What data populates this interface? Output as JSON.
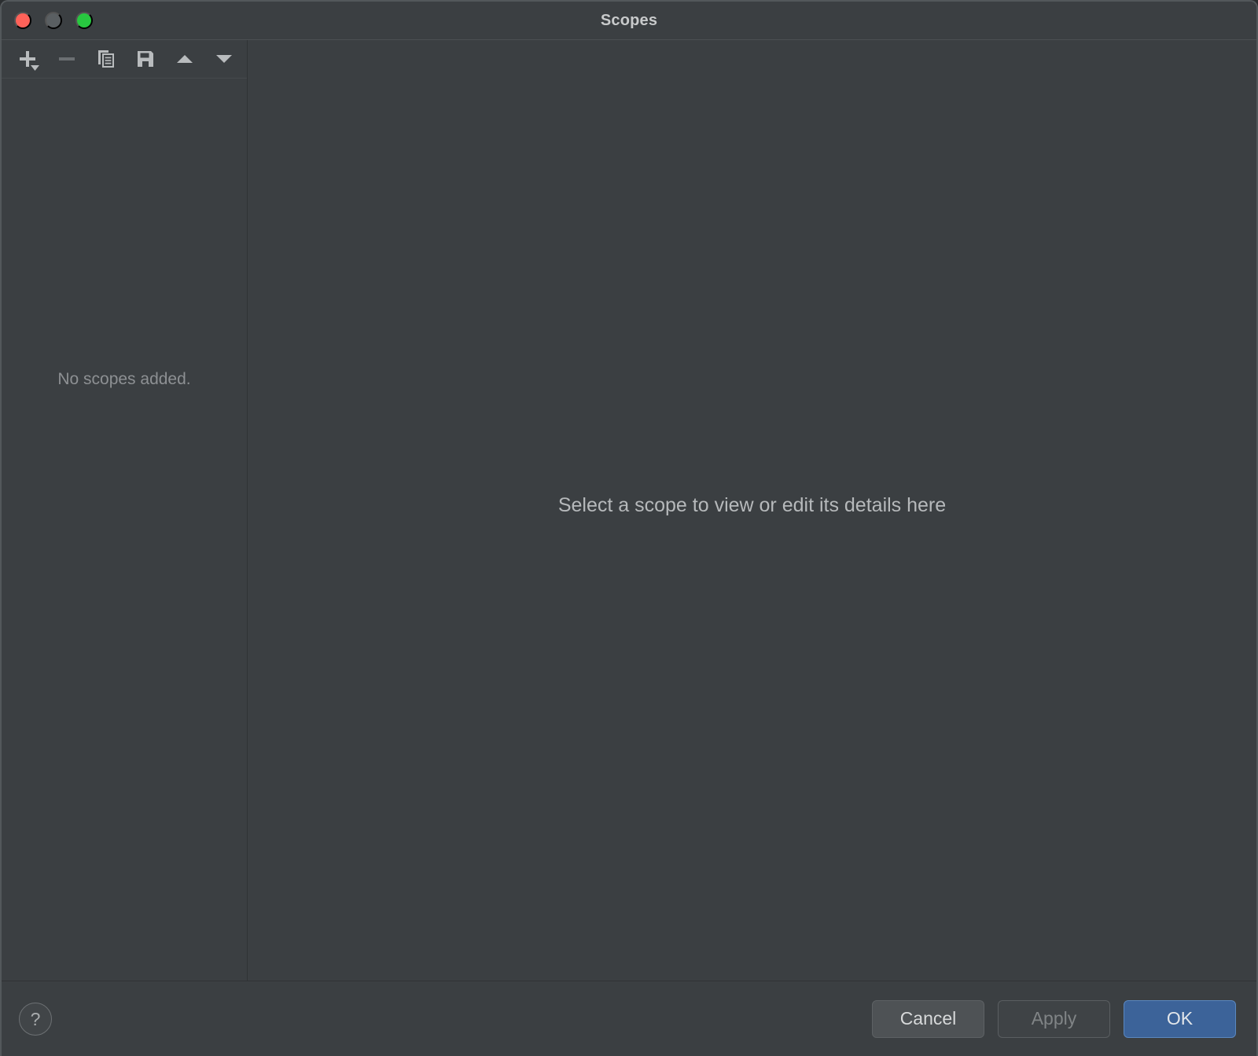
{
  "window": {
    "title": "Scopes",
    "traffic_lights": [
      {
        "name": "close",
        "color": "#ff6259"
      },
      {
        "name": "minimize",
        "color": "#5a5f62"
      },
      {
        "name": "zoom",
        "color": "#28c840"
      }
    ]
  },
  "toolbar": {
    "buttons": [
      {
        "icon": "add-icon",
        "label": "Add Scope",
        "enabled": true,
        "has_dropdown": true
      },
      {
        "icon": "remove-icon",
        "label": "Remove Scope",
        "enabled": false,
        "has_dropdown": false
      },
      {
        "icon": "copy-icon",
        "label": "Duplicate",
        "enabled": true,
        "has_dropdown": false
      },
      {
        "icon": "save-icon",
        "label": "Save",
        "enabled": true,
        "has_dropdown": false
      },
      {
        "icon": "arrow-up-icon",
        "label": "Move Up",
        "enabled": true,
        "has_dropdown": false
      },
      {
        "icon": "arrow-down-icon",
        "label": "Move Down",
        "enabled": true,
        "has_dropdown": false
      }
    ]
  },
  "left_panel": {
    "empty_message": "No scopes added."
  },
  "right_panel": {
    "placeholder": "Select a scope to view or edit its details here"
  },
  "footer": {
    "help_label": "?",
    "cancel_label": "Cancel",
    "apply_label": "Apply",
    "ok_label": "OK"
  },
  "colors": {
    "window_background": "#3b3f42",
    "divider": "#303335",
    "primary_button": "#3c6399",
    "text_primary": "#c8cacb",
    "text_muted": "#8d9093"
  }
}
